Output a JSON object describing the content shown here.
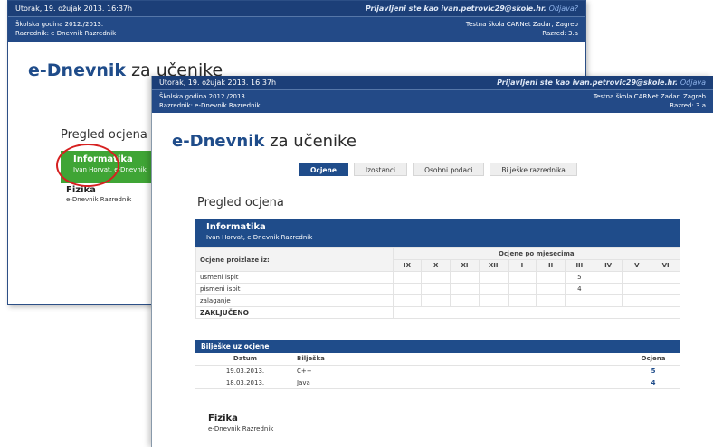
{
  "back_window": {
    "topbar": {
      "datetime": "Utorak, 19. ožujak 2013. 16:37h",
      "login_prefix": "Prijavljeni ste kao ivan.petrovic29@skole.hr.",
      "logout": "Odjava?"
    },
    "info": {
      "school_year": "Školska godina 2012./2013.",
      "class_teacher": "Razrednik: e Dnevnik Razrednik",
      "school": "Testna škola CARNet Zadar, Zagreb",
      "class": "Razred: 3.a"
    },
    "brand": {
      "strong": "e-Dnevnik",
      "rest": " za učenike"
    },
    "section_title": "Pregled ocjena",
    "subjects": [
      {
        "name": "Informatika",
        "teacher": "Ivan Horvat, e-Dnevnik"
      },
      {
        "name": "Fizika",
        "teacher": "e-Dnevnik Razrednik"
      }
    ]
  },
  "front_window": {
    "topbar": {
      "datetime": "Utorak, 19. ožujak 2013. 16:37h",
      "login_prefix": "Prijavljeni ste kao ivan.petrovic29@skole.hr.",
      "logout": "Odjava"
    },
    "info": {
      "school_year": "Školska godina 2012./2013.",
      "class_teacher": "Razrednik: e-Dnevnik Razrednik",
      "school": "Testna škola CARNet Zadar, Zagreb",
      "class": "Razred: 3.a"
    },
    "brand": {
      "strong": "e-Dnevnik",
      "rest": " za učenike"
    },
    "tabs": [
      {
        "label": "Ocjene",
        "active": true
      },
      {
        "label": "Izostanci",
        "active": false
      },
      {
        "label": "Osobni podaci",
        "active": false
      },
      {
        "label": "Bilješke razrednika",
        "active": false
      }
    ],
    "section_title": "Pregled ocjena",
    "subject": {
      "name": "Informatika",
      "teacher": "Ivan Horvat, e Dnevnik Razrednik"
    },
    "grades_table": {
      "first_header": "Ocjene proizlaze iz:",
      "group_header": "Ocjene po mjesecima",
      "months": [
        "IX",
        "X",
        "XI",
        "XII",
        "I",
        "II",
        "III",
        "IV",
        "V",
        "VI"
      ],
      "rows": [
        {
          "label": "usmeni ispit",
          "cells": [
            "",
            "",
            "",
            "",
            "",
            "",
            "5",
            "",
            "",
            ""
          ]
        },
        {
          "label": "pismeni ispit",
          "cells": [
            "",
            "",
            "",
            "",
            "",
            "",
            "4",
            "",
            "",
            ""
          ]
        },
        {
          "label": "zalaganje",
          "cells": [
            "",
            "",
            "",
            "",
            "",
            "",
            "",
            "",
            "",
            ""
          ]
        }
      ],
      "final_label": "ZAKLJUČENO"
    },
    "notes": {
      "title": "Bilješke uz ocjene",
      "headers": {
        "date": "Datum",
        "note": "Bilješka",
        "grade": "Ocjena"
      },
      "rows": [
        {
          "date": "19.03.2013.",
          "note": "C++",
          "grade": "5"
        },
        {
          "date": "18.03.2013.",
          "note": "Java",
          "grade": "4"
        }
      ]
    },
    "second_subject": {
      "name": "Fizika",
      "teacher": "e-Dnevnik Razrednik"
    }
  },
  "colors": {
    "header_blue": "#1f4c8a",
    "active_subject_green": "#3fa535",
    "highlight_red": "#d62020"
  }
}
